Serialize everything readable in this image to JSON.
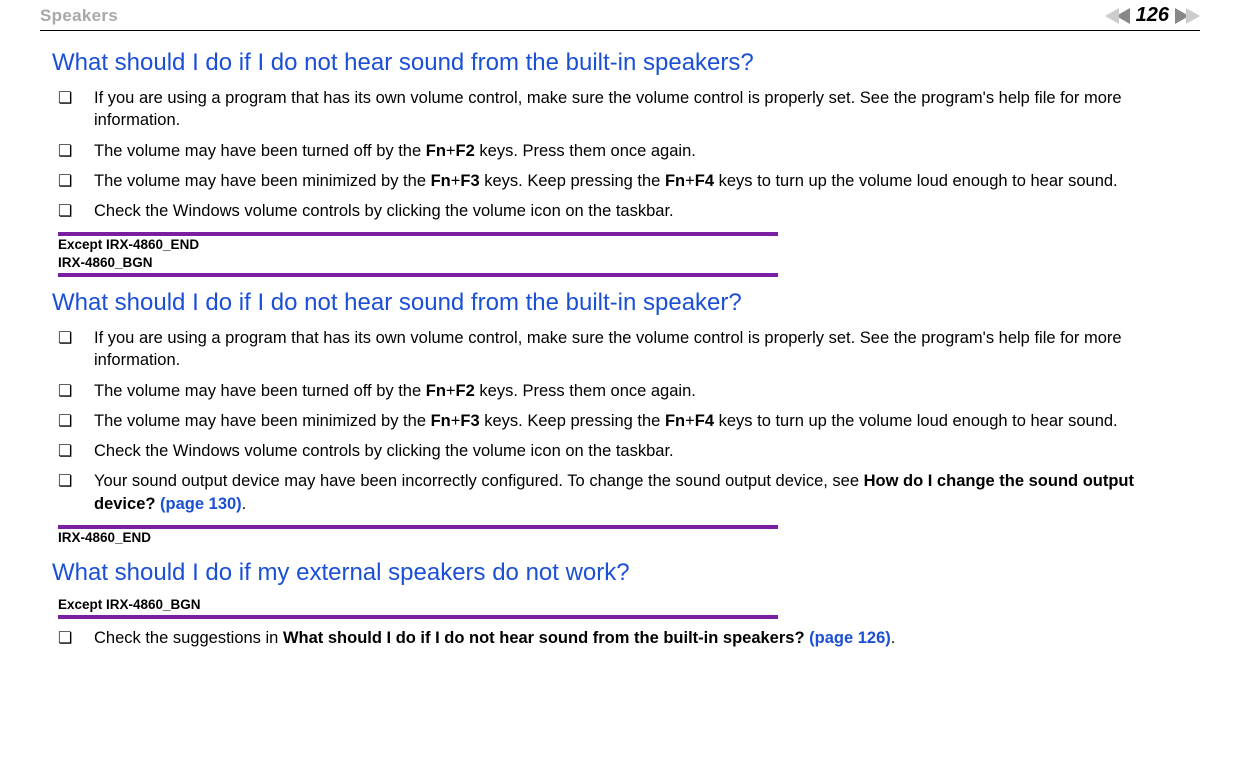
{
  "header": {
    "section": "Speakers",
    "page_number": "126"
  },
  "sections": [
    {
      "title": "What should I do if I do not hear sound from the built-in speakers?",
      "items": [
        {
          "pre": "If you are using a program that has its own volume control, make sure the volume control is properly set. See the program's help file for more information."
        },
        {
          "pre": "The volume may have been turned off by the ",
          "b1": "Fn",
          "mid1": "+",
          "b2": "F2",
          "post": " keys. Press them once again."
        },
        {
          "pre": "The volume may have been minimized by the ",
          "b1": "Fn",
          "mid1": "+",
          "b2": "F3",
          "mid2": " keys. Keep pressing the ",
          "b3": "Fn",
          "mid3": "+",
          "b4": "F4",
          "post": " keys to turn up the volume loud enough to hear sound."
        },
        {
          "pre": "Check the Windows volume controls by clicking the volume icon on the taskbar."
        }
      ]
    },
    {
      "title": "What should I do if I do not hear sound from the built-in speaker?",
      "items": [
        {
          "pre": "If you are using a program that has its own volume control, make sure the volume control is properly set. See the program's help file for more information."
        },
        {
          "pre": "The volume may have been turned off by the ",
          "b1": "Fn",
          "mid1": "+",
          "b2": "F2",
          "post": " keys. Press them once again."
        },
        {
          "pre": "The volume may have been minimized by the ",
          "b1": "Fn",
          "mid1": "+",
          "b2": "F3",
          "mid2": " keys. Keep pressing the ",
          "b3": "Fn",
          "mid3": "+",
          "b4": "F4",
          "post": " keys to turn up the volume loud enough to hear sound."
        },
        {
          "pre": "Check the Windows volume controls by clicking the volume icon on the taskbar."
        },
        {
          "pre": "Your sound output device may have been incorrectly configured. To change the sound output device, see ",
          "b1": "How do I change the sound output device? ",
          "link": "(page 130)",
          "post": "."
        }
      ]
    },
    {
      "title": "What should I do if my external speakers do not work?",
      "items": [
        {
          "pre": "Check the suggestions in ",
          "b1": "What should I do if I do not hear sound from the built-in speakers? ",
          "link": "(page 126)",
          "post": "."
        }
      ]
    }
  ],
  "markers": {
    "m1_line1": "Except IRX-4860_END",
    "m1_line2": "IRX-4860_BGN",
    "m2": "IRX-4860_END",
    "m3": "Except IRX-4860_BGN"
  }
}
